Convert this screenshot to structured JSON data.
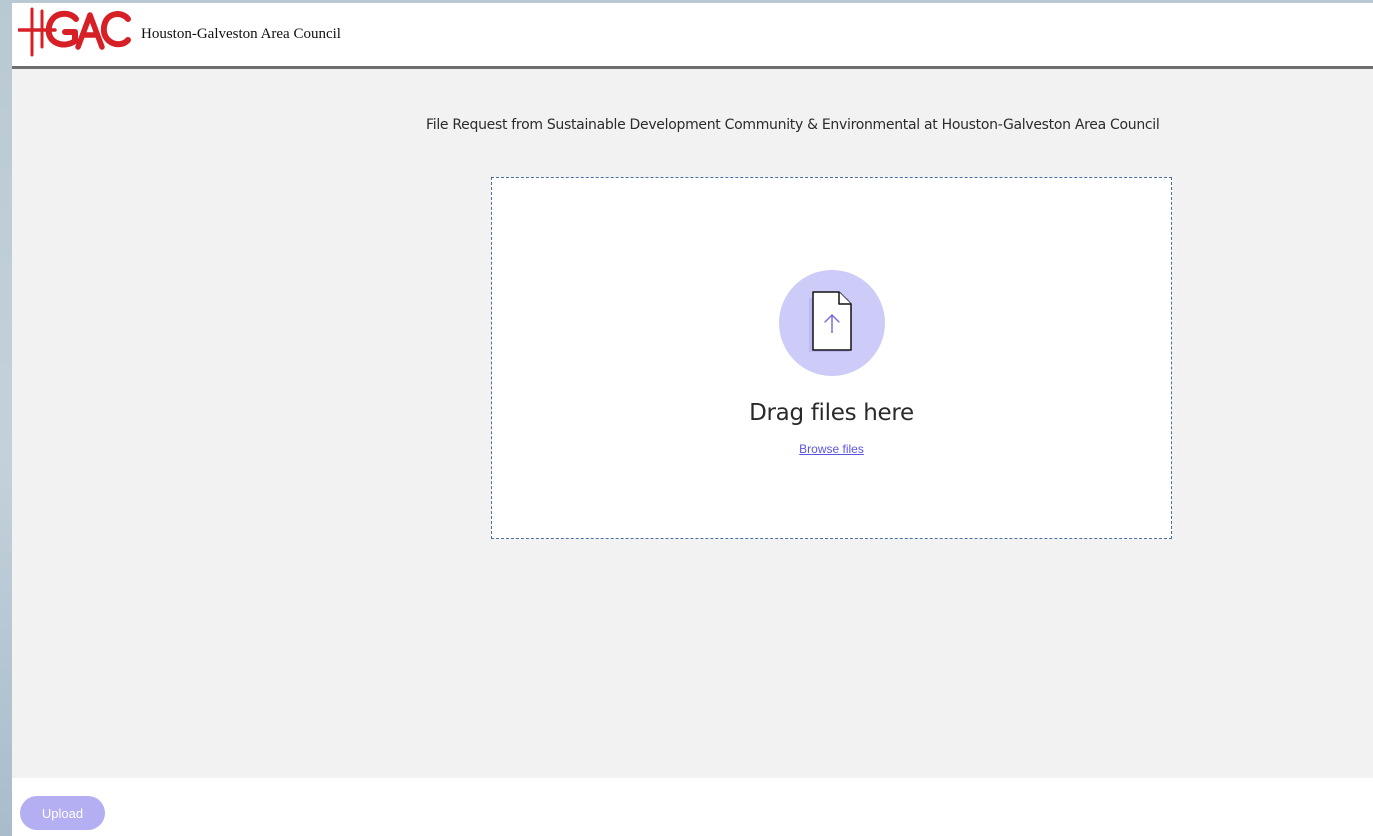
{
  "header": {
    "logo_text": "HGAC",
    "org_name": "Houston-Galveston Area Council"
  },
  "main": {
    "request_title": "File Request from Sustainable Development Community & Environmental at Houston-Galveston Area Council",
    "dropzone": {
      "icon": "file-upload-icon",
      "drag_text": "Drag files here",
      "browse_label": "Browse files"
    }
  },
  "footer": {
    "upload_label": "Upload"
  },
  "colors": {
    "brand_red": "#d71f26",
    "accent_purple": "#5b55e6",
    "upload_button": "#b4aef3",
    "illustration_circle": "#cdcbf7"
  }
}
